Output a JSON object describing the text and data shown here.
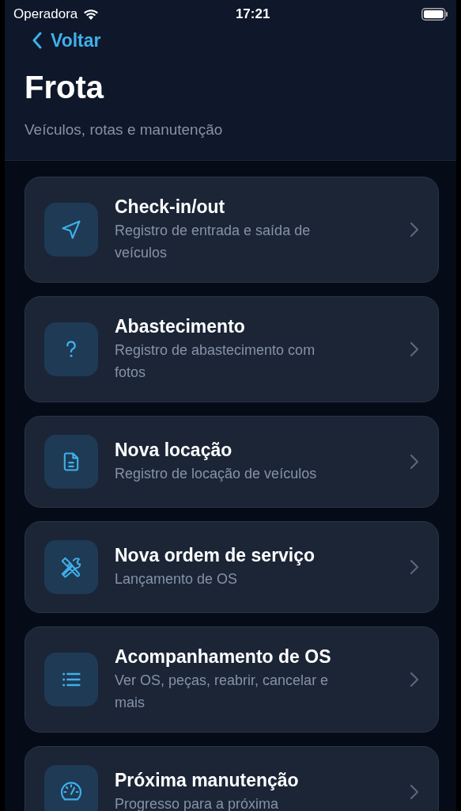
{
  "status_bar": {
    "carrier": "Operadora",
    "time": "17:21"
  },
  "nav": {
    "back": "Voltar"
  },
  "header": {
    "title": "Frota",
    "subtitle": "Veículos, rotas e manutenção"
  },
  "menu_items": [
    {
      "title": "Check-in/out",
      "description": "Registro de entrada e saída de veículos"
    },
    {
      "title": "Abastecimento",
      "description": "Registro de abastecimento com fotos"
    },
    {
      "title": "Nova locação",
      "description": "Registro de locação de veículos"
    },
    {
      "title": "Nova ordem de serviço",
      "description": "Lançamento de OS"
    },
    {
      "title": "Acompanhamento de OS",
      "description": "Ver OS, peças, reabrir, cancelar e mais"
    },
    {
      "title": "Próxima manutenção",
      "description": "Progresso para a próxima"
    }
  ]
}
